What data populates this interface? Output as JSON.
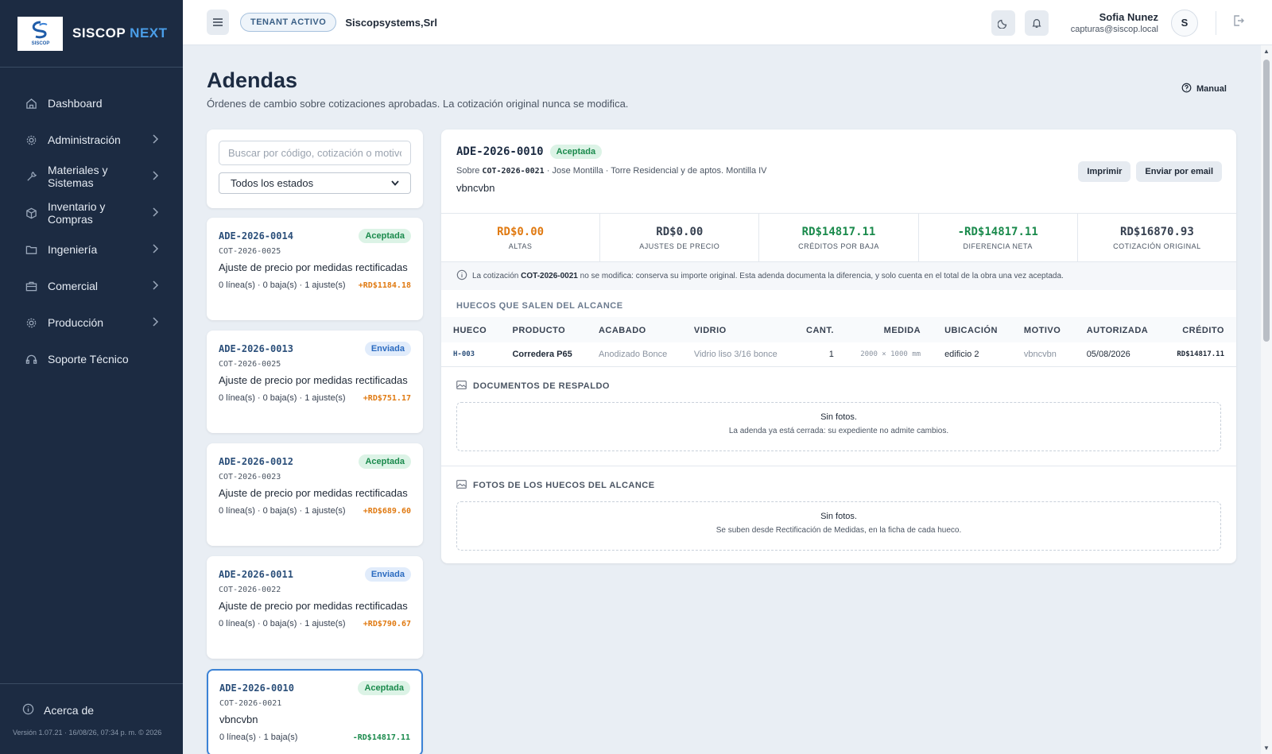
{
  "brand": {
    "name_part1": "SISCOP",
    "name_part2": "NEXT",
    "logo_text": "SISCOP"
  },
  "sidebar": {
    "items": [
      {
        "label": "Dashboard",
        "icon": "home-icon"
      },
      {
        "label": "Administración",
        "icon": "gear-icon"
      },
      {
        "label": "Materiales y Sistemas",
        "icon": "wrench-icon"
      },
      {
        "label": "Inventario y Compras",
        "icon": "box-icon"
      },
      {
        "label": "Ingeniería",
        "icon": "folder-icon"
      },
      {
        "label": "Comercial",
        "icon": "briefcase-icon"
      },
      {
        "label": "Producción",
        "icon": "gear-icon"
      },
      {
        "label": "Soporte Técnico",
        "icon": "headset-icon"
      }
    ],
    "about": "Acerca de",
    "version": "Versión 1.07.21 · 16/08/26, 07:34 p. m. © 2026"
  },
  "topbar": {
    "tenant_label": "TENANT ACTIVO",
    "tenant_name": "Siscopsystems,Srl",
    "user_name": "Sofia Nunez",
    "user_email": "capturas@siscop.local",
    "avatar_initial": "S"
  },
  "page": {
    "title": "Adendas",
    "subtitle": "Órdenes de cambio sobre cotizaciones aprobadas. La cotización original nunca se modifica.",
    "manual": "Manual"
  },
  "filters": {
    "search_placeholder": "Buscar por código, cotización o motivo",
    "status_selected": "Todos los estados"
  },
  "list": [
    {
      "code": "ADE-2026-0014",
      "status": "Aceptada",
      "cot": "COT-2026-0025",
      "desc": "Ajuste de precio por medidas rectificadas",
      "meta": "0 línea(s) · 0 baja(s) · 1 ajuste(s)",
      "amount": "+RD$1184.18"
    },
    {
      "code": "ADE-2026-0013",
      "status": "Enviada",
      "cot": "COT-2026-0025",
      "desc": "Ajuste de precio por medidas rectificadas",
      "meta": "0 línea(s) · 0 baja(s) · 1 ajuste(s)",
      "amount": "+RD$751.17"
    },
    {
      "code": "ADE-2026-0012",
      "status": "Aceptada",
      "cot": "COT-2026-0023",
      "desc": "Ajuste de precio por medidas rectificadas",
      "meta": "0 línea(s) · 0 baja(s) · 1 ajuste(s)",
      "amount": "+RD$689.60"
    },
    {
      "code": "ADE-2026-0011",
      "status": "Enviada",
      "cot": "COT-2026-0022",
      "desc": "Ajuste de precio por medidas rectificadas",
      "meta": "0 línea(s) · 0 baja(s) · 1 ajuste(s)",
      "amount": "+RD$790.67"
    },
    {
      "code": "ADE-2026-0010",
      "status": "Aceptada",
      "cot": "COT-2026-0021",
      "desc": "vbncvbn",
      "meta": "0 línea(s) · 1 baja(s)",
      "amount": "-RD$14817.11"
    }
  ],
  "detail": {
    "code": "ADE-2026-0010",
    "status": "Aceptada",
    "sobre_prefix": "Sobre",
    "cot": "COT-2026-0021",
    "sobre_rest": "· Jose Montilla · Torre Residencial y de aptos. Montilla IV",
    "note": "vbncvbn",
    "print_label": "Imprimir",
    "email_label": "Enviar por email",
    "stats": [
      {
        "value": "RD$0.00",
        "label": "ALTAS"
      },
      {
        "value": "RD$0.00",
        "label": "AJUSTES DE PRECIO"
      },
      {
        "value": "RD$14817.11",
        "label": "CRÉDITOS POR BAJA"
      },
      {
        "value": "-RD$14817.11",
        "label": "DIFERENCIA NETA"
      },
      {
        "value": "RD$16870.93",
        "label": "COTIZACIÓN ORIGINAL"
      }
    ],
    "info_prefix": "La cotización",
    "info_cot": "COT-2026-0021",
    "info_rest": "no se modifica: conserva su importe original. Esta adenda documenta la diferencia, y solo cuenta en el total de la obra una vez aceptada.",
    "huecos_title": "HUECOS QUE SALEN DEL ALCANCE",
    "table": {
      "headers": [
        "HUECO",
        "PRODUCTO",
        "ACABADO",
        "VIDRIO",
        "CANT.",
        "MEDIDA",
        "UBICACIÓN",
        "MOTIVO",
        "AUTORIZADA",
        "CRÉDITO"
      ],
      "rows": [
        [
          "H-003",
          "Corredera P65",
          "Anodizado Bonce",
          "Vidrio liso 3/16 bonce",
          "1",
          "2000 × 1000 mm",
          "edificio 2",
          "vbncvbn",
          "05/08/2026",
          "RD$14817.11"
        ]
      ]
    },
    "docs_title": "DOCUMENTOS DE RESPALDO",
    "docs_empty": "Sin fotos.",
    "docs_sub": "La adenda ya está cerrada: su expediente no admite cambios.",
    "photos_title": "FOTOS DE LOS HUECOS DEL ALCANCE",
    "photos_empty": "Sin fotos.",
    "photos_sub": "Se suben desde Rectificación de Medidas, en la ficha de cada hueco."
  }
}
